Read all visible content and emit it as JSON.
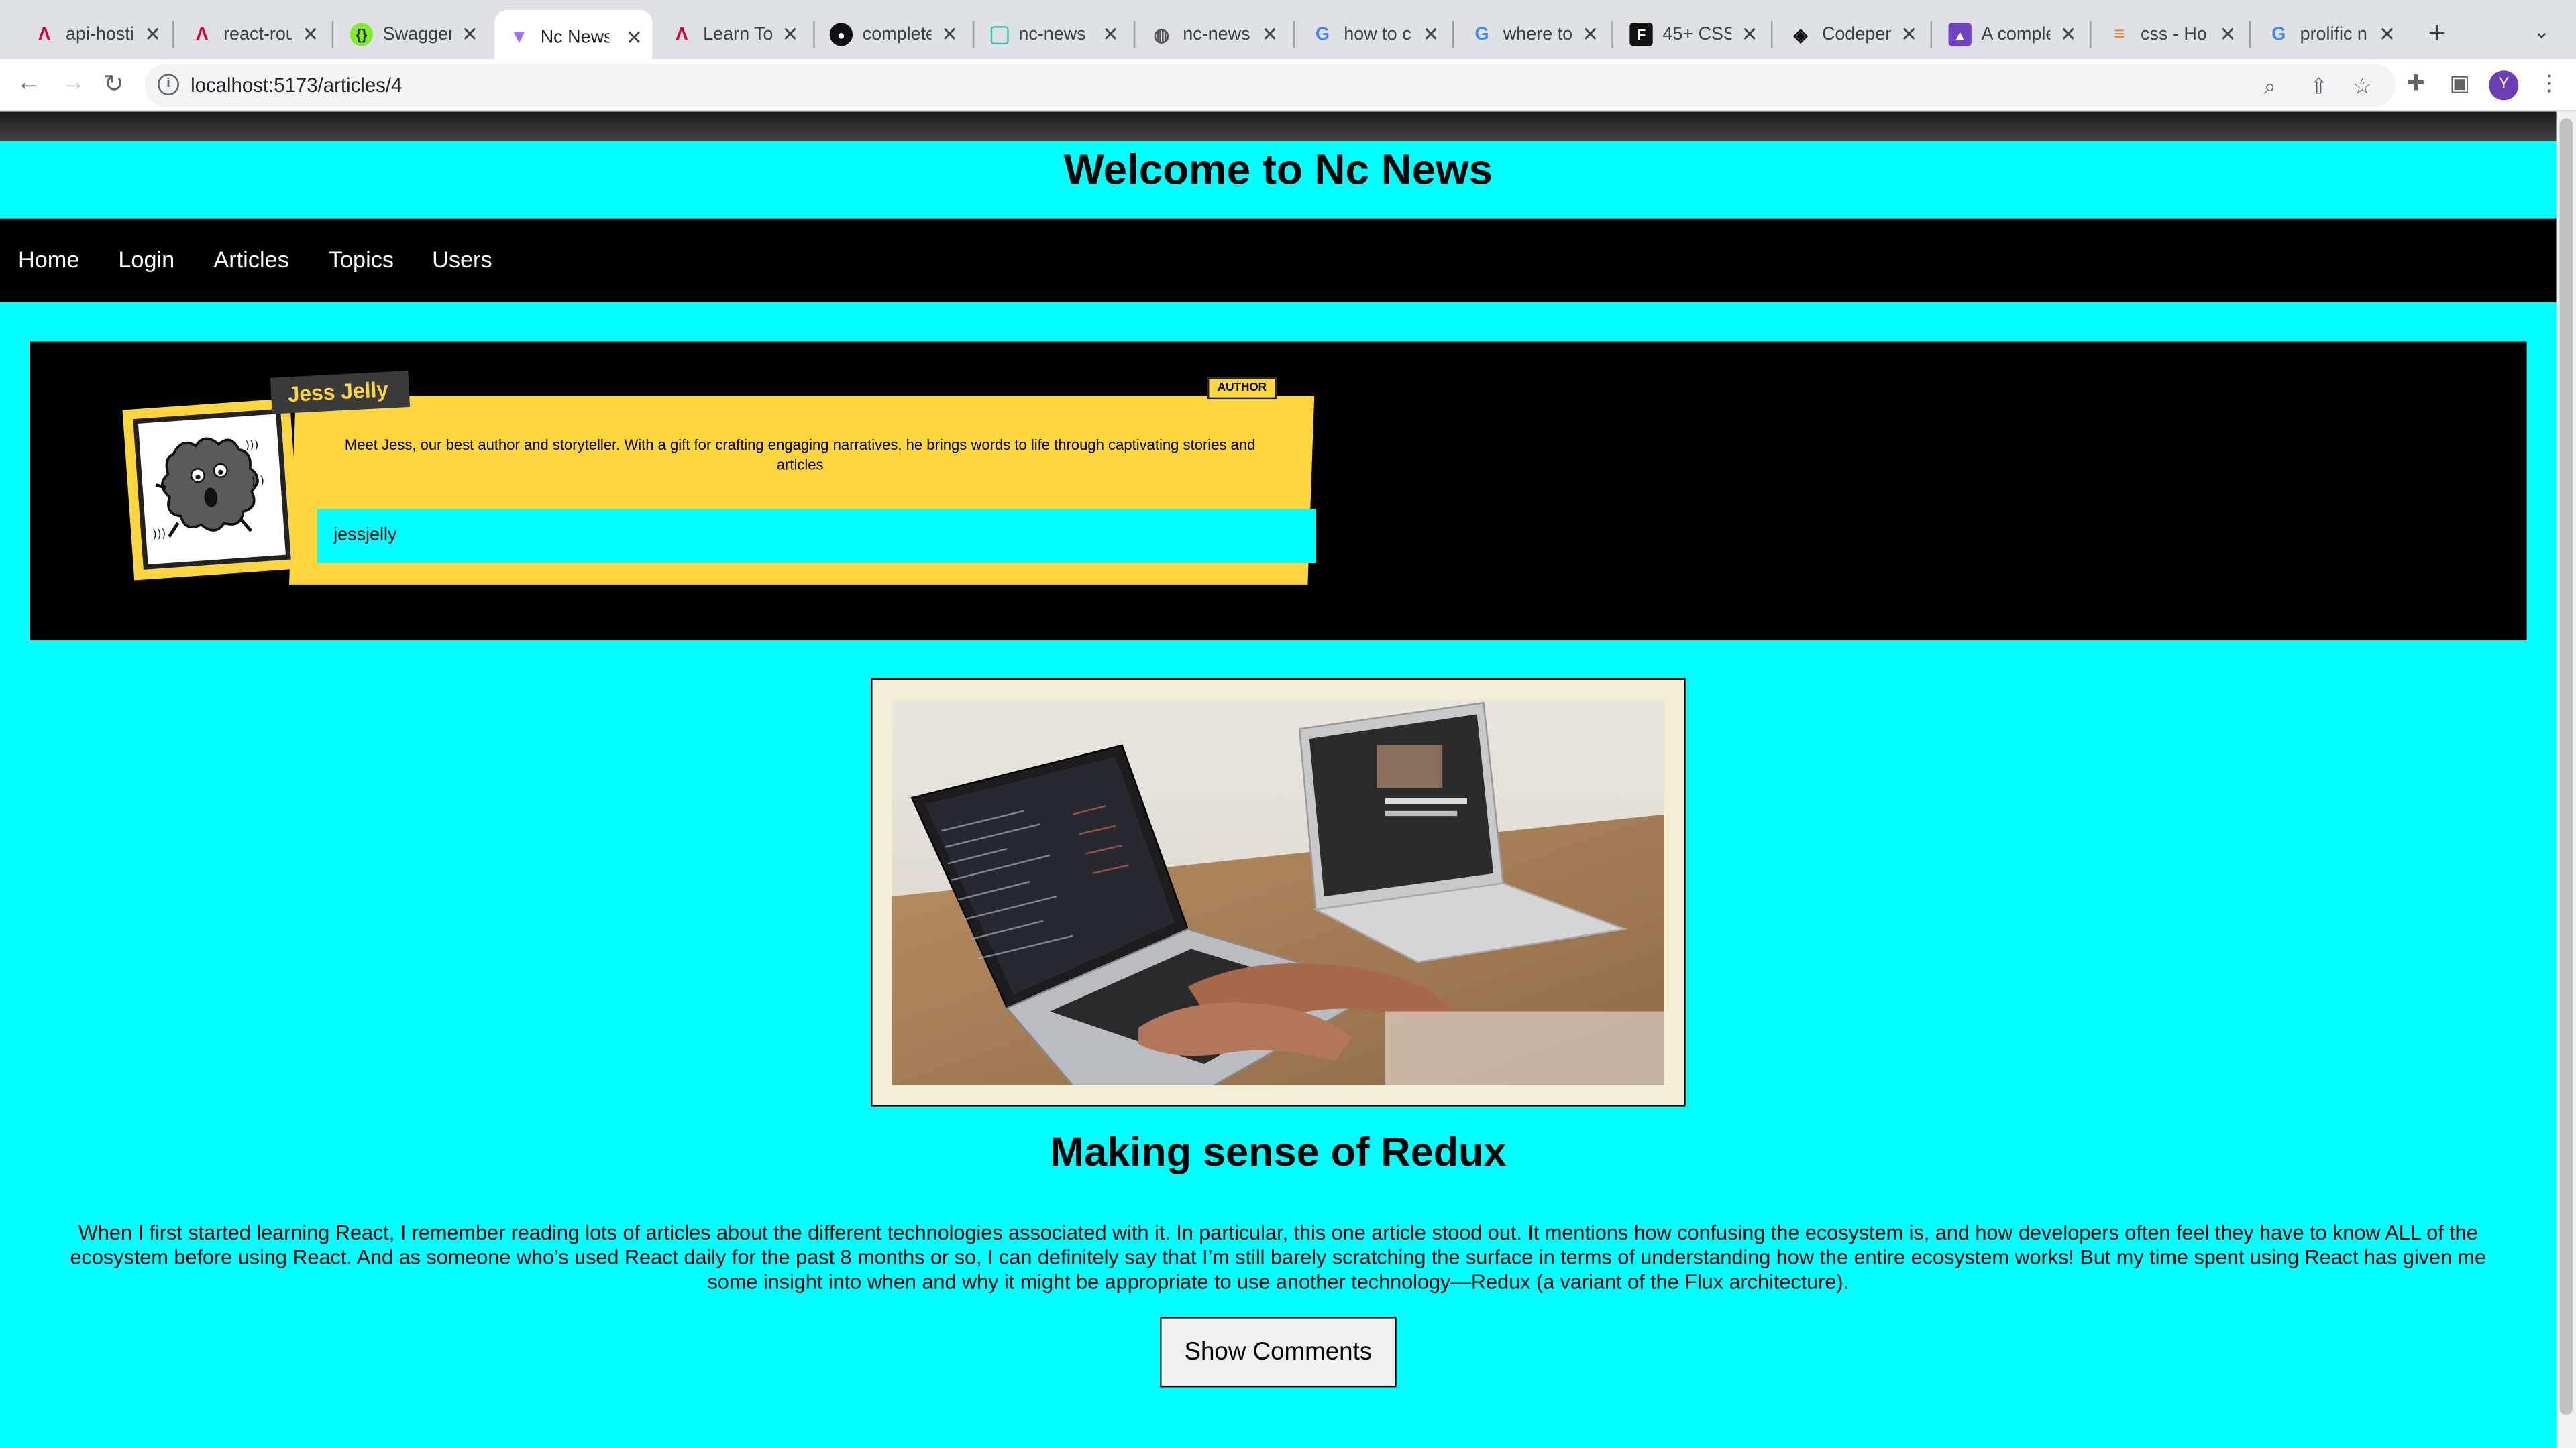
{
  "browser": {
    "tabs": [
      {
        "title": "api-hosti",
        "icon": "angular-red-icon",
        "active": false
      },
      {
        "title": "react-rou",
        "icon": "angular-red-icon",
        "active": false
      },
      {
        "title": "Swagger",
        "icon": "swagger-icon",
        "active": false
      },
      {
        "title": "Nc News",
        "icon": "vite-icon",
        "active": true
      },
      {
        "title": "Learn To",
        "icon": "angular-red-icon",
        "active": false
      },
      {
        "title": "complete",
        "icon": "github-icon",
        "active": false
      },
      {
        "title": "nc-news",
        "icon": "netlify-icon",
        "active": false
      },
      {
        "title": "nc-news",
        "icon": "globe-icon",
        "active": false
      },
      {
        "title": "how to c",
        "icon": "google-icon",
        "active": false
      },
      {
        "title": "where to",
        "icon": "google-icon",
        "active": false
      },
      {
        "title": "45+ CSS",
        "icon": "freefrontend-icon",
        "active": false
      },
      {
        "title": "Codepen",
        "icon": "codepen-icon",
        "active": false
      },
      {
        "title": "A comple",
        "icon": "purple-book-icon",
        "active": false
      },
      {
        "title": "css - Ho",
        "icon": "stackoverflow-icon",
        "active": false
      },
      {
        "title": "prolific n",
        "icon": "google-icon",
        "active": false
      }
    ],
    "url": "localhost:5173/articles/4",
    "avatar_letter": "Y"
  },
  "site": {
    "title": "Welcome to Nc News",
    "nav": [
      "Home",
      "Login",
      "Articles",
      "Topics",
      "Users"
    ]
  },
  "author": {
    "name": "Jess Jelly",
    "badge": "AUTHOR",
    "bio": "Meet Jess, our best author and storyteller. With a gift for crafting engaging narratives, he brings words to life through captivating stories and articles",
    "username": "jessjelly"
  },
  "article": {
    "title": "Making sense of Redux",
    "body": "When I first started learning React, I remember reading lots of articles about the different technologies associated with it. In particular, this one article stood out. It mentions how confusing the ecosystem is, and how developers often feel they have to know ALL of the ecosystem before using React. And as someone who’s used React daily for the past 8 months or so, I can definitely say that I’m still barely scratching the surface in terms of understanding how the entire ecosystem works! But my time spent using React has given me some insight into when and why it might be appropriate to use another technology—Redux (a variant of the Flux architecture).",
    "comments_button": "Show Comments"
  },
  "colors": {
    "page_bg": "#00ffff",
    "nav_bg": "#000000",
    "card_yellow": "#fcd53f"
  }
}
